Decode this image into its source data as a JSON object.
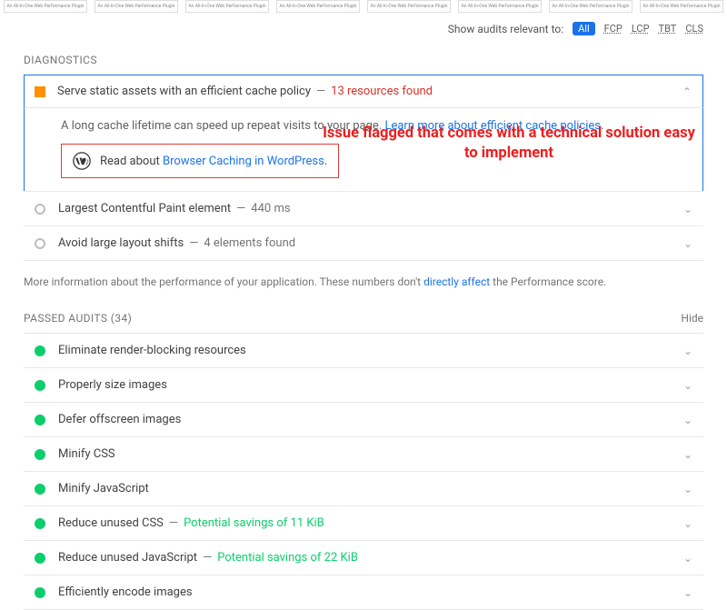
{
  "thumb_label": "An All-In-One Web Performance Plugin",
  "filter": {
    "label": "Show audits relevant to:",
    "active": "All",
    "metrics": [
      "FCP",
      "LCP",
      "TBT",
      "CLS"
    ]
  },
  "diagnostics": {
    "heading": "DIAGNOSTICS",
    "expanded": {
      "title": "Serve static assets with an efficient cache policy",
      "sub": "13 resources found",
      "desc_prefix": "A long cache lifetime can speed up repeat visits to your page. ",
      "desc_link": "Learn more about efficient cache policies",
      "desc_suffix": ".",
      "callout_prefix": "Read about ",
      "callout_link": "Browser Caching in WordPress",
      "callout_suffix": "."
    },
    "items": [
      {
        "title": "Largest Contentful Paint element",
        "sub": "440 ms",
        "sub_class": "grey"
      },
      {
        "title": "Avoid large layout shifts",
        "sub": "4 elements found",
        "sub_class": "grey"
      }
    ],
    "footnote_prefix": "More information about the performance of your application. These numbers don't ",
    "footnote_link": "directly affect",
    "footnote_suffix": " the Performance score."
  },
  "passed": {
    "heading": "PASSED AUDITS",
    "count": "(34)",
    "hide": "Hide",
    "items": [
      {
        "title": "Eliminate render-blocking resources"
      },
      {
        "title": "Properly size images"
      },
      {
        "title": "Defer offscreen images"
      },
      {
        "title": "Minify CSS"
      },
      {
        "title": "Minify JavaScript"
      },
      {
        "title": "Reduce unused CSS",
        "sub": "Potential savings of 11 KiB"
      },
      {
        "title": "Reduce unused JavaScript",
        "sub": "Potential savings of 22 KiB"
      },
      {
        "title": "Efficiently encode images"
      }
    ]
  },
  "annotation": "Issue flagged that comes with a technical solution easy to implement"
}
